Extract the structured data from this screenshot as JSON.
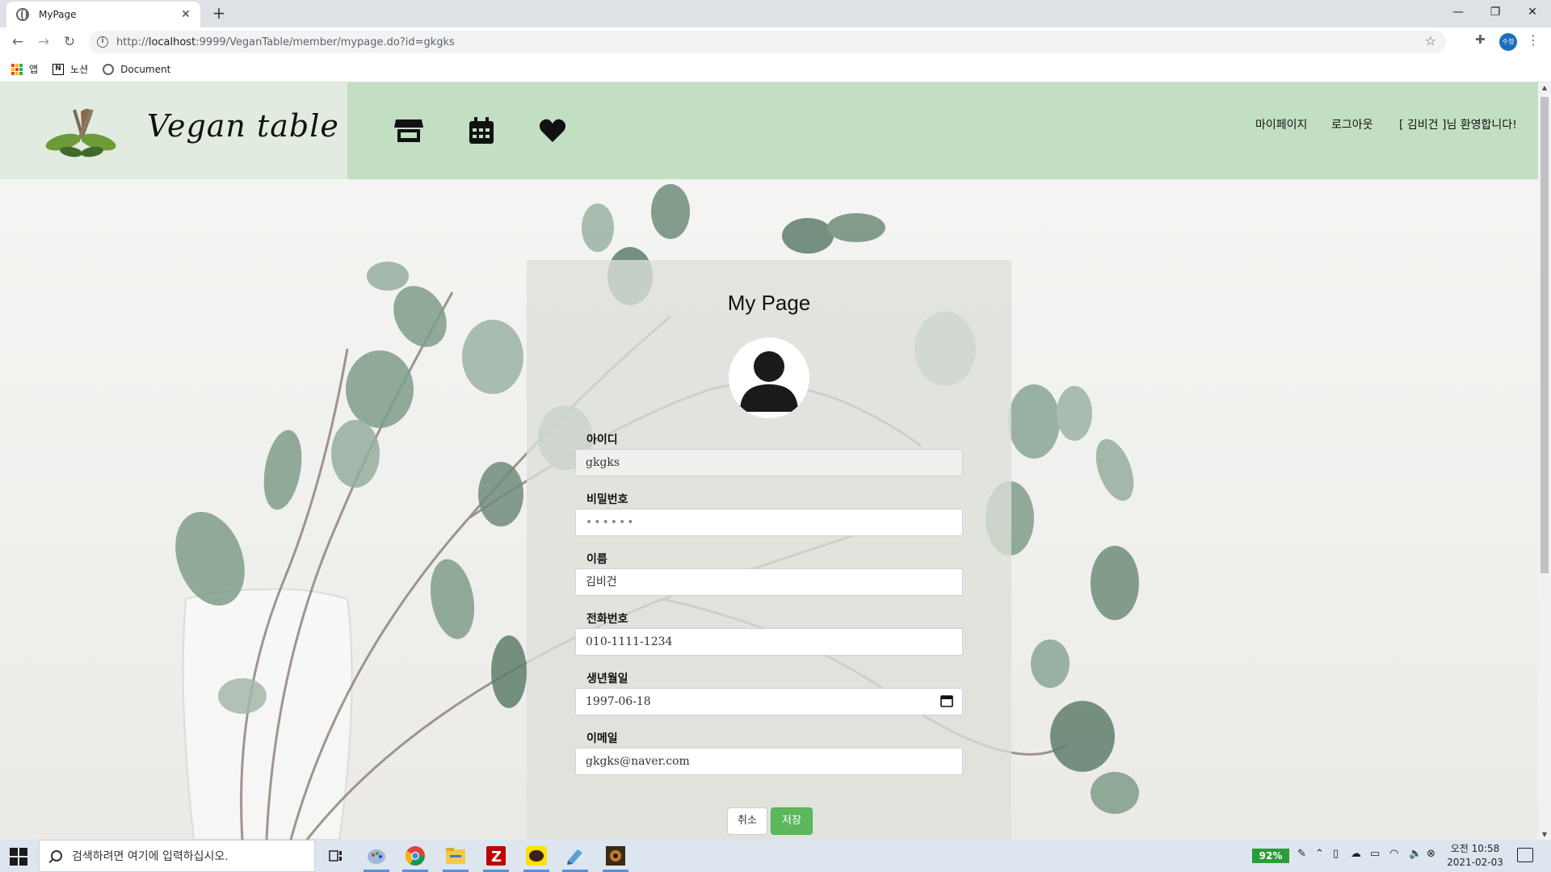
{
  "browser": {
    "tab_title": "MyPage",
    "url_prefix": "http://",
    "url_host": "localhost",
    "url_rest": ":9999/VeganTable/member/mypage.do?id=gkgks",
    "profile_initials": "수정",
    "bookmarks": [
      {
        "label": "앱",
        "icon": "apps-icon"
      },
      {
        "label": "노션",
        "icon": "notion-icon"
      },
      {
        "label": "Document",
        "icon": "globe-icon"
      }
    ]
  },
  "site": {
    "brand_name": "Vegan table",
    "nav_icons": [
      "store-icon",
      "calendar-icon",
      "heart-icon"
    ],
    "menu": {
      "mypage": "마이페이지",
      "logout": "로그아웃",
      "welcome": "[ 김비건 ]님 환영합니다!"
    },
    "colors": {
      "brand_bg": "#e2ebdf",
      "nav_bg": "#c3dfc3",
      "save_button": "#5cb85c"
    }
  },
  "form": {
    "title": "My Page",
    "fields": {
      "id": {
        "label": "아이디",
        "value": "gkgks"
      },
      "password": {
        "label": "비밀번호",
        "value": "••••••"
      },
      "name": {
        "label": "이름",
        "value": "김비건"
      },
      "phone": {
        "label": "전화번호",
        "value": "010-1111-1234"
      },
      "birth": {
        "label": "생년월일",
        "value": "1997-06-18"
      },
      "email": {
        "label": "이메일",
        "value": "gkgks@naver.com"
      }
    },
    "cancel_label": "취소",
    "save_label": "저장"
  },
  "taskbar": {
    "search_placeholder": "검색하려면 여기에 입력하십시오.",
    "battery": "92%",
    "time": "오전 10:58",
    "date": "2021-02-03"
  }
}
